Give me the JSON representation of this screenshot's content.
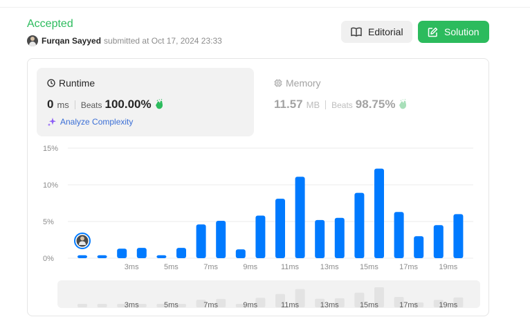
{
  "header": {
    "status": "Accepted",
    "user_name": "Furqan Sayyed",
    "submitted_text": "submitted at Oct 17, 2024 23:33"
  },
  "buttons": {
    "editorial_label": "Editorial",
    "solution_label": "Solution"
  },
  "runtime": {
    "title": "Runtime",
    "value": "0",
    "unit": "ms",
    "beats_label": "Beats",
    "beats_pct": "100.00%",
    "analyze_label": "Analyze Complexity"
  },
  "memory": {
    "title": "Memory",
    "value": "11.57",
    "unit": "MB",
    "beats_label": "Beats",
    "beats_pct": "98.75%"
  },
  "colors": {
    "accepted": "#2cbb5d",
    "bar": "#007aff",
    "nav_bar": "#e3e3e3",
    "analyze": "#3b6fd6"
  },
  "icons": [
    "book-icon",
    "edit-icon",
    "clock-icon",
    "chip-icon",
    "clap-hands-icon",
    "sparkle-icon",
    "avatar"
  ],
  "chart_data": {
    "type": "bar",
    "x": [
      1,
      2,
      3,
      4,
      5,
      6,
      7,
      8,
      9,
      10,
      11,
      12,
      13,
      14,
      15,
      16,
      17,
      18,
      19,
      20
    ],
    "values": [
      0.4,
      0.4,
      1.3,
      1.4,
      0.4,
      1.4,
      4.6,
      5.1,
      1.2,
      5.8,
      8.1,
      11.1,
      5.2,
      5.5,
      8.9,
      12.2,
      6.3,
      3.0,
      4.5,
      6.0
    ],
    "xticks": [
      "3ms",
      "5ms",
      "7ms",
      "9ms",
      "11ms",
      "13ms",
      "15ms",
      "17ms",
      "19ms"
    ],
    "yticks": [
      "0%",
      "5%",
      "10%",
      "15%"
    ],
    "ylim": [
      0,
      15
    ],
    "grid": true,
    "highlight_x": 1,
    "highlight_label": "avatar"
  }
}
